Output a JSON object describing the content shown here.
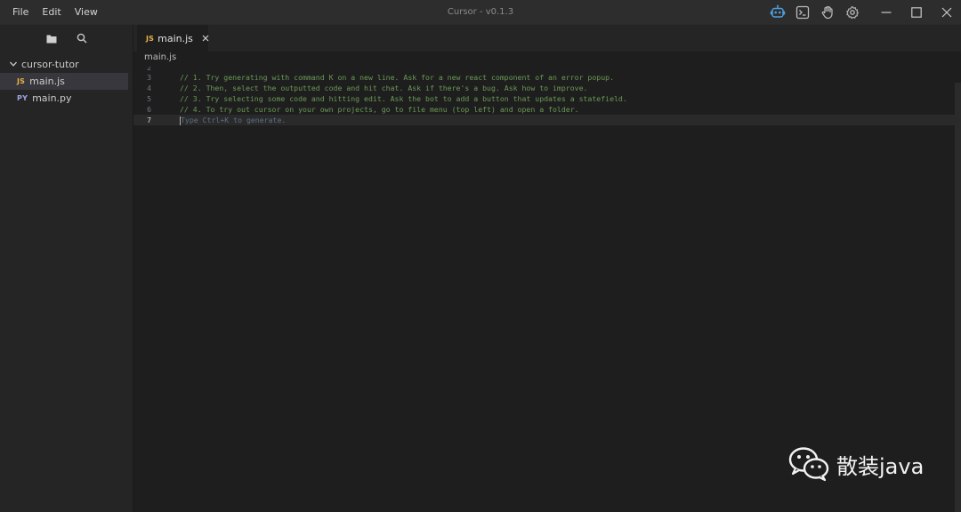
{
  "titlebar": {
    "menu": [
      "File",
      "Edit",
      "View"
    ],
    "title": "Cursor - v0.1.3",
    "tools": [
      "robot-icon",
      "terminal-icon",
      "hand-icon",
      "gear-icon"
    ],
    "window_controls": [
      "minimize-icon",
      "maximize-icon",
      "close-icon"
    ]
  },
  "sidebar": {
    "tabs": [
      "folder-icon",
      "search-icon"
    ],
    "folder": "cursor-tutor",
    "files": [
      {
        "type": "JS",
        "name": "main.js",
        "active": true
      },
      {
        "type": "PY",
        "name": "main.py",
        "active": false
      }
    ]
  },
  "editor": {
    "tab": {
      "type": "JS",
      "name": "main.js"
    },
    "breadcrumb": "main.js",
    "lines": [
      {
        "number": "2",
        "text": ""
      },
      {
        "number": "3",
        "text": "// 1. Try generating with command K on a new line. Ask for a new react component of an error popup."
      },
      {
        "number": "4",
        "text": "// 2. Then, select the outputted code and hit chat. Ask if there's a bug. Ask how to improve."
      },
      {
        "number": "5",
        "text": "// 3. Try selecting some code and hitting edit. Ask the bot to add a button that updates a statefield."
      },
      {
        "number": "6",
        "text": "// 4. To try out cursor on your own projects, go to file menu (top left) and open a folder."
      },
      {
        "number": "7",
        "text": ""
      }
    ],
    "placeholder": "Type Ctrl+K to generate."
  },
  "watermark": {
    "text": "散装java"
  },
  "colors": {
    "accent": "#4f9fe0",
    "comment": "#6a9955",
    "background": "#1e1e1e"
  }
}
